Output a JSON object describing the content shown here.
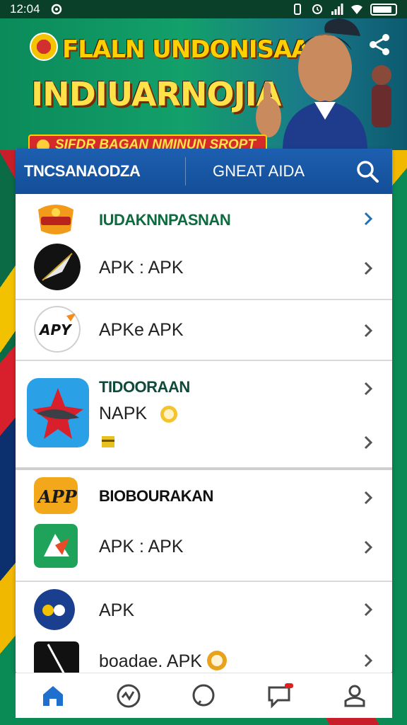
{
  "status_bar": {
    "time": "12:04"
  },
  "banner": {
    "title_line1": "FLALN UNDONISAA",
    "title_line2": "INDIUARNOJIA",
    "subtitle": "SIFDR BAGAN NMINUN SROPT",
    "share_icon": "share-icon"
  },
  "tabs": {
    "tab1": "TNCSANAODZA",
    "tab2": "GNEAT AIDA",
    "search_icon": "search-icon"
  },
  "list": {
    "section1_header": "IUDAKNNPASNAN",
    "item1_label": "APK : APK",
    "item2_label": "APKe APK",
    "section2_header": "TIDOORAAN",
    "item3_label": "NAPK",
    "section3_header": "BIOBOURAKAN",
    "item4_label": "APK : APK",
    "item5_label": "APK",
    "item6_label": "boadae. APK"
  },
  "colors": {
    "tab_bar": "#1a58a6",
    "header_green": "#0d6b3f",
    "chevron_blue": "#1f6fb5",
    "nav_active": "#1f6fcf"
  },
  "bottom_nav": {
    "icons": [
      "home-icon",
      "activity-icon",
      "chat-bubble-icon",
      "messages-icon",
      "profile-icon"
    ]
  }
}
